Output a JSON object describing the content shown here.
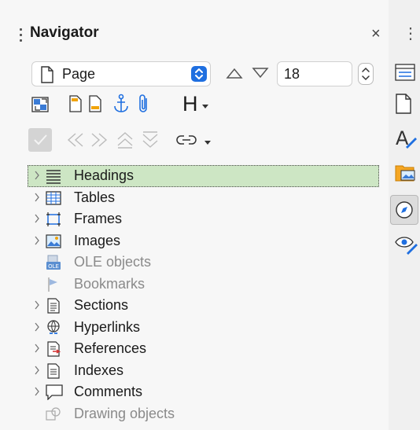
{
  "navigator": {
    "title": "Navigator",
    "close": "×",
    "sidebar_menu": "⋮"
  },
  "toolbar": {
    "category": "Page",
    "page_number": "18",
    "heading_menu": "H"
  },
  "tree": {
    "items": [
      {
        "label": "Headings",
        "expandable": true,
        "enabled": true,
        "selected": true
      },
      {
        "label": "Tables",
        "expandable": true,
        "enabled": true
      },
      {
        "label": "Frames",
        "expandable": true,
        "enabled": true
      },
      {
        "label": "Images",
        "expandable": true,
        "enabled": true
      },
      {
        "label": "OLE objects",
        "expandable": false,
        "enabled": false
      },
      {
        "label": "Bookmarks",
        "expandable": false,
        "enabled": false
      },
      {
        "label": "Sections",
        "expandable": true,
        "enabled": true
      },
      {
        "label": "Hyperlinks",
        "expandable": true,
        "enabled": true
      },
      {
        "label": "References",
        "expandable": true,
        "enabled": true
      },
      {
        "label": "Indexes",
        "expandable": true,
        "enabled": true
      },
      {
        "label": "Comments",
        "expandable": true,
        "enabled": true
      },
      {
        "label": "Drawing objects",
        "expandable": false,
        "enabled": false
      }
    ]
  },
  "colors": {
    "accent": "#1f6fe0",
    "selection": "#cde6c4",
    "disabled": "#8a8a8a"
  }
}
